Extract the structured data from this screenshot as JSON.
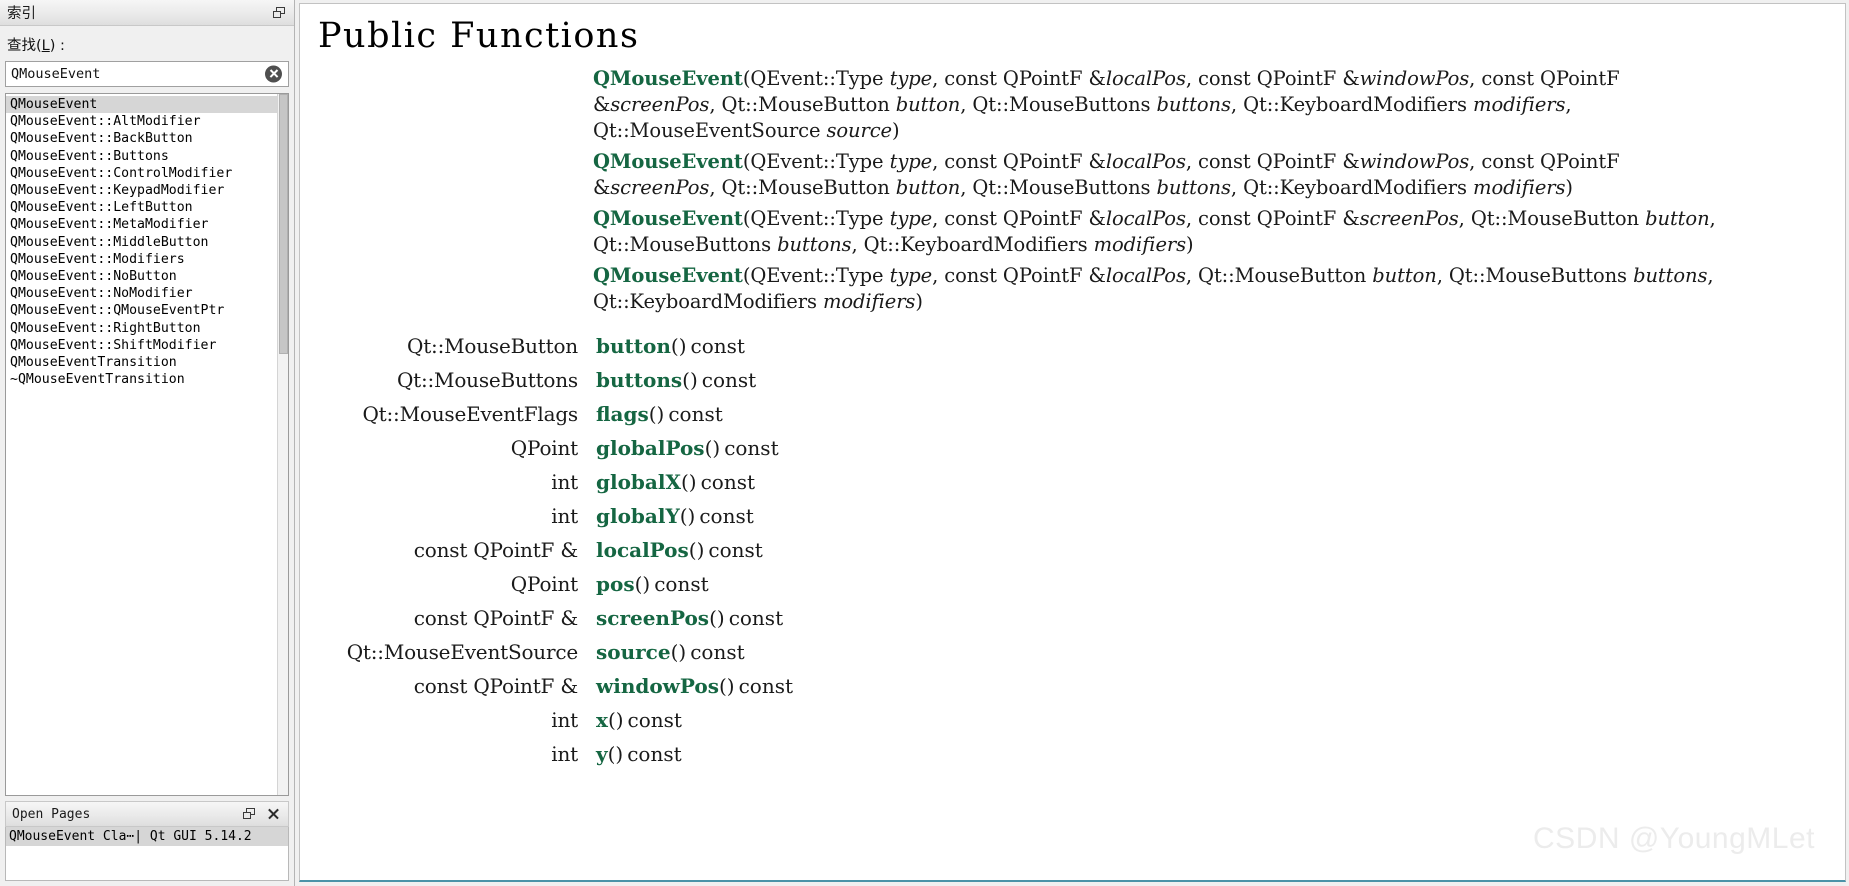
{
  "left_dock": {
    "index_panel": {
      "title": "索引",
      "float_icon": "restore-icon",
      "close_icon": "close-icon",
      "find_label_prefix": "查找(",
      "find_label_key": "L",
      "find_label_suffix": ") :",
      "search_value": "QMouseEvent",
      "search_placeholder": "QMouseEvent",
      "clear_icon": "clear-circle-icon",
      "items": [
        "QMouseEvent",
        "QMouseEvent::AltModifier",
        "QMouseEvent::BackButton",
        "QMouseEvent::Buttons",
        "QMouseEvent::ControlModifier",
        "QMouseEvent::KeypadModifier",
        "QMouseEvent::LeftButton",
        "QMouseEvent::MetaModifier",
        "QMouseEvent::MiddleButton",
        "QMouseEvent::Modifiers",
        "QMouseEvent::NoButton",
        "QMouseEvent::NoModifier",
        "QMouseEvent::QMouseEventPtr",
        "QMouseEvent::RightButton",
        "QMouseEvent::ShiftModifier",
        "QMouseEventTransition",
        "~QMouseEventTransition"
      ],
      "selected_index": 0
    },
    "open_pages_panel": {
      "title": "Open Pages",
      "float_icon": "restore-icon",
      "close_icon": "close-icon",
      "items": [
        "QMouseEvent Cla⋯| Qt GUI 5.14.2"
      ]
    }
  },
  "main": {
    "page_title": "Public Functions",
    "constructors": [
      {
        "name": "QMouseEvent",
        "lines": [
          [
            {
              "t": "(QEvent::Type ",
              "s": "plain"
            },
            {
              "t": "type",
              "s": "param"
            },
            {
              "t": ", const QPointF &",
              "s": "plain"
            },
            {
              "t": "localPos",
              "s": "param"
            },
            {
              "t": ", const QPointF &",
              "s": "plain"
            },
            {
              "t": "windowPos",
              "s": "param"
            },
            {
              "t": ", const QPointF",
              "s": "plain"
            }
          ],
          [
            {
              "t": "&",
              "s": "plain"
            },
            {
              "t": "screenPos",
              "s": "param"
            },
            {
              "t": ", Qt::MouseButton ",
              "s": "plain"
            },
            {
              "t": "button",
              "s": "param"
            },
            {
              "t": ", Qt::MouseButtons ",
              "s": "plain"
            },
            {
              "t": "buttons",
              "s": "param"
            },
            {
              "t": ", Qt::KeyboardModifiers ",
              "s": "plain"
            },
            {
              "t": "modifiers",
              "s": "param"
            },
            {
              "t": ",",
              "s": "plain"
            }
          ],
          [
            {
              "t": "Qt::MouseEventSource ",
              "s": "plain"
            },
            {
              "t": "source",
              "s": "param"
            },
            {
              "t": ")",
              "s": "plain"
            }
          ]
        ]
      },
      {
        "name": "QMouseEvent",
        "lines": [
          [
            {
              "t": "(QEvent::Type ",
              "s": "plain"
            },
            {
              "t": "type",
              "s": "param"
            },
            {
              "t": ", const QPointF &",
              "s": "plain"
            },
            {
              "t": "localPos",
              "s": "param"
            },
            {
              "t": ", const QPointF &",
              "s": "plain"
            },
            {
              "t": "windowPos",
              "s": "param"
            },
            {
              "t": ", const QPointF",
              "s": "plain"
            }
          ],
          [
            {
              "t": "&",
              "s": "plain"
            },
            {
              "t": "screenPos",
              "s": "param"
            },
            {
              "t": ", Qt::MouseButton ",
              "s": "plain"
            },
            {
              "t": "button",
              "s": "param"
            },
            {
              "t": ", Qt::MouseButtons ",
              "s": "plain"
            },
            {
              "t": "buttons",
              "s": "param"
            },
            {
              "t": ", Qt::KeyboardModifiers ",
              "s": "plain"
            },
            {
              "t": "modifiers",
              "s": "param"
            },
            {
              "t": ")",
              "s": "plain"
            }
          ]
        ]
      },
      {
        "name": "QMouseEvent",
        "lines": [
          [
            {
              "t": "(QEvent::Type ",
              "s": "plain"
            },
            {
              "t": "type",
              "s": "param"
            },
            {
              "t": ", const QPointF &",
              "s": "plain"
            },
            {
              "t": "localPos",
              "s": "param"
            },
            {
              "t": ", const QPointF &",
              "s": "plain"
            },
            {
              "t": "screenPos",
              "s": "param"
            },
            {
              "t": ", Qt::MouseButton ",
              "s": "plain"
            },
            {
              "t": "button",
              "s": "param"
            },
            {
              "t": ",",
              "s": "plain"
            }
          ],
          [
            {
              "t": "Qt::MouseButtons ",
              "s": "plain"
            },
            {
              "t": "buttons",
              "s": "param"
            },
            {
              "t": ", Qt::KeyboardModifiers ",
              "s": "plain"
            },
            {
              "t": "modifiers",
              "s": "param"
            },
            {
              "t": ")",
              "s": "plain"
            }
          ]
        ]
      },
      {
        "name": "QMouseEvent",
        "lines": [
          [
            {
              "t": "(QEvent::Type ",
              "s": "plain"
            },
            {
              "t": "type",
              "s": "param"
            },
            {
              "t": ", const QPointF &",
              "s": "plain"
            },
            {
              "t": "localPos",
              "s": "param"
            },
            {
              "t": ", Qt::MouseButton ",
              "s": "plain"
            },
            {
              "t": "button",
              "s": "param"
            },
            {
              "t": ", Qt::MouseButtons ",
              "s": "plain"
            },
            {
              "t": "buttons",
              "s": "param"
            },
            {
              "t": ",",
              "s": "plain"
            }
          ],
          [
            {
              "t": "Qt::KeyboardModifiers ",
              "s": "plain"
            },
            {
              "t": "modifiers",
              "s": "param"
            },
            {
              "t": ")",
              "s": "plain"
            }
          ]
        ]
      }
    ],
    "functions": [
      {
        "ret": "Qt::MouseButton",
        "name": "button",
        "sig": "()",
        "qual": "const"
      },
      {
        "ret": "Qt::MouseButtons",
        "name": "buttons",
        "sig": "()",
        "qual": "const"
      },
      {
        "ret": "Qt::MouseEventFlags",
        "name": "flags",
        "sig": "()",
        "qual": "const"
      },
      {
        "ret": "QPoint",
        "name": "globalPos",
        "sig": "()",
        "qual": "const"
      },
      {
        "ret": "int",
        "name": "globalX",
        "sig": "()",
        "qual": "const"
      },
      {
        "ret": "int",
        "name": "globalY",
        "sig": "()",
        "qual": "const"
      },
      {
        "ret": "const QPointF &",
        "name": "localPos",
        "sig": "()",
        "qual": "const"
      },
      {
        "ret": "QPoint",
        "name": "pos",
        "sig": "()",
        "qual": "const"
      },
      {
        "ret": "const QPointF &",
        "name": "screenPos",
        "sig": "()",
        "qual": "const"
      },
      {
        "ret": "Qt::MouseEventSource",
        "name": "source",
        "sig": "()",
        "qual": "const"
      },
      {
        "ret": "const QPointF &",
        "name": "windowPos",
        "sig": "()",
        "qual": "const"
      },
      {
        "ret": "int",
        "name": "x",
        "sig": "()",
        "qual": "const"
      },
      {
        "ret": "int",
        "name": "y",
        "sig": "()",
        "qual": "const"
      }
    ],
    "watermark": "CSDN @YoungMLet"
  },
  "colors": {
    "function_name": "#156642",
    "dock_bg": "#f0f0f0",
    "selection": "#d6d6d6",
    "accent_underline": "#4a93a8",
    "watermark": "#ececec"
  }
}
